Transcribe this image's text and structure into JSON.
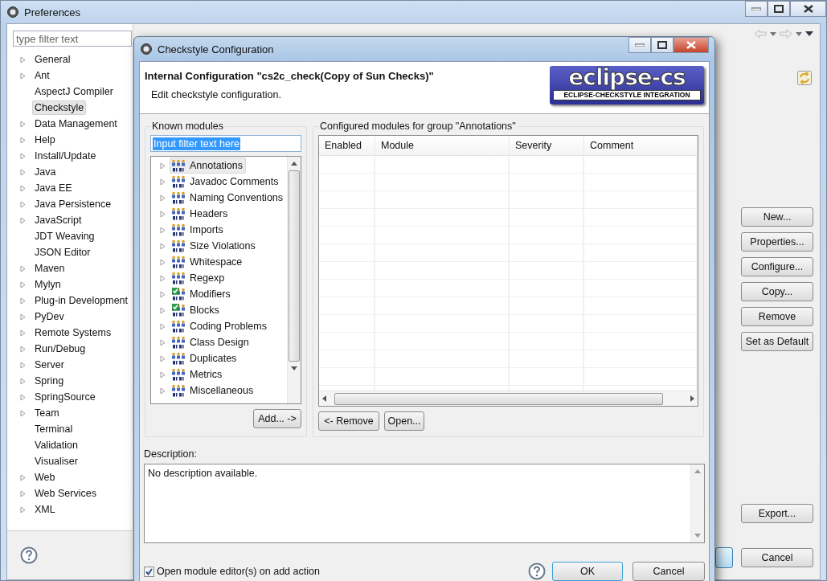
{
  "preferences": {
    "title": "Preferences",
    "filter": {
      "placeholder": "type filter text"
    },
    "tree": [
      {
        "label": "General",
        "expandable": true,
        "selected": false
      },
      {
        "label": "Ant",
        "expandable": true,
        "selected": false
      },
      {
        "label": "AspectJ Compiler",
        "expandable": false,
        "selected": false
      },
      {
        "label": "Checkstyle",
        "expandable": false,
        "selected": true
      },
      {
        "label": "Data Management",
        "expandable": true,
        "selected": false
      },
      {
        "label": "Help",
        "expandable": true,
        "selected": false
      },
      {
        "label": "Install/Update",
        "expandable": true,
        "selected": false
      },
      {
        "label": "Java",
        "expandable": true,
        "selected": false
      },
      {
        "label": "Java EE",
        "expandable": true,
        "selected": false
      },
      {
        "label": "Java Persistence",
        "expandable": true,
        "selected": false
      },
      {
        "label": "JavaScript",
        "expandable": true,
        "selected": false
      },
      {
        "label": "JDT Weaving",
        "expandable": false,
        "selected": false
      },
      {
        "label": "JSON Editor",
        "expandable": false,
        "selected": false
      },
      {
        "label": "Maven",
        "expandable": true,
        "selected": false
      },
      {
        "label": "Mylyn",
        "expandable": true,
        "selected": false
      },
      {
        "label": "Plug-in Development",
        "expandable": true,
        "selected": false
      },
      {
        "label": "PyDev",
        "expandable": true,
        "selected": false
      },
      {
        "label": "Remote Systems",
        "expandable": true,
        "selected": false
      },
      {
        "label": "Run/Debug",
        "expandable": true,
        "selected": false
      },
      {
        "label": "Server",
        "expandable": true,
        "selected": false
      },
      {
        "label": "Spring",
        "expandable": true,
        "selected": false
      },
      {
        "label": "SpringSource",
        "expandable": true,
        "selected": false
      },
      {
        "label": "Team",
        "expandable": true,
        "selected": false
      },
      {
        "label": "Terminal",
        "expandable": false,
        "selected": false
      },
      {
        "label": "Validation",
        "expandable": false,
        "selected": false
      },
      {
        "label": "Visualiser",
        "expandable": false,
        "selected": false
      },
      {
        "label": "Web",
        "expandable": true,
        "selected": false
      },
      {
        "label": "Web Services",
        "expandable": true,
        "selected": false
      },
      {
        "label": "XML",
        "expandable": true,
        "selected": false
      }
    ],
    "side_buttons": [
      "New...",
      "Properties...",
      "Configure...",
      "Copy...",
      "Remove",
      "Set as Default"
    ],
    "export_button": "Export...",
    "cancel_button": "Cancel"
  },
  "dialog": {
    "title": "Checkstyle Configuration",
    "heading": "Internal Configuration \"cs2c_check(Copy of Sun Checks)\"",
    "subtitle": "Edit checkstyle configuration.",
    "logo": {
      "name": "eclipse-cs",
      "tagline": "ECLIPSE-CHECKSTYLE INTEGRATION"
    },
    "known_modules": {
      "title": "Known modules",
      "filter": {
        "value": "Input filter text here",
        "selected": true
      },
      "modules": [
        {
          "label": "Annotations",
          "selected": true,
          "checked": false
        },
        {
          "label": "Javadoc Comments",
          "selected": false,
          "checked": false
        },
        {
          "label": "Naming Conventions",
          "selected": false,
          "checked": false
        },
        {
          "label": "Headers",
          "selected": false,
          "checked": false
        },
        {
          "label": "Imports",
          "selected": false,
          "checked": false
        },
        {
          "label": "Size Violations",
          "selected": false,
          "checked": false
        },
        {
          "label": "Whitespace",
          "selected": false,
          "checked": false
        },
        {
          "label": "Regexp",
          "selected": false,
          "checked": false
        },
        {
          "label": "Modifiers",
          "selected": false,
          "checked": true
        },
        {
          "label": "Blocks",
          "selected": false,
          "checked": true
        },
        {
          "label": "Coding Problems",
          "selected": false,
          "checked": false
        },
        {
          "label": "Class Design",
          "selected": false,
          "checked": false
        },
        {
          "label": "Duplicates",
          "selected": false,
          "checked": false
        },
        {
          "label": "Metrics",
          "selected": false,
          "checked": false
        },
        {
          "label": "Miscellaneous",
          "selected": false,
          "checked": false
        }
      ],
      "add_button": "Add... ->"
    },
    "configured": {
      "title": "Configured modules for group \"Annotations\"",
      "columns": [
        "Enabled",
        "Module",
        "Severity",
        "Comment"
      ],
      "buttons": [
        "<- Remove",
        "Open..."
      ]
    },
    "description": {
      "label": "Description:",
      "value": "No description available."
    },
    "open_editor": {
      "label": "Open module editor(s) on add action",
      "checked": true
    },
    "buttons": [
      "OK",
      "Cancel"
    ]
  }
}
